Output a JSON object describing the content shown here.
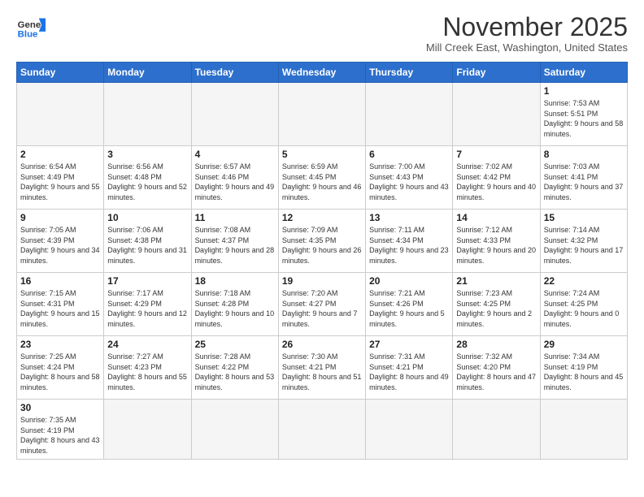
{
  "header": {
    "logo_general": "General",
    "logo_blue": "Blue",
    "month": "November 2025",
    "location": "Mill Creek East, Washington, United States"
  },
  "weekdays": [
    "Sunday",
    "Monday",
    "Tuesday",
    "Wednesday",
    "Thursday",
    "Friday",
    "Saturday"
  ],
  "weeks": [
    [
      {
        "day": "",
        "info": ""
      },
      {
        "day": "",
        "info": ""
      },
      {
        "day": "",
        "info": ""
      },
      {
        "day": "",
        "info": ""
      },
      {
        "day": "",
        "info": ""
      },
      {
        "day": "",
        "info": ""
      },
      {
        "day": "1",
        "info": "Sunrise: 7:53 AM\nSunset: 5:51 PM\nDaylight: 9 hours and 58 minutes."
      }
    ],
    [
      {
        "day": "2",
        "info": "Sunrise: 6:54 AM\nSunset: 4:49 PM\nDaylight: 9 hours and 55 minutes."
      },
      {
        "day": "3",
        "info": "Sunrise: 6:56 AM\nSunset: 4:48 PM\nDaylight: 9 hours and 52 minutes."
      },
      {
        "day": "4",
        "info": "Sunrise: 6:57 AM\nSunset: 4:46 PM\nDaylight: 9 hours and 49 minutes."
      },
      {
        "day": "5",
        "info": "Sunrise: 6:59 AM\nSunset: 4:45 PM\nDaylight: 9 hours and 46 minutes."
      },
      {
        "day": "6",
        "info": "Sunrise: 7:00 AM\nSunset: 4:43 PM\nDaylight: 9 hours and 43 minutes."
      },
      {
        "day": "7",
        "info": "Sunrise: 7:02 AM\nSunset: 4:42 PM\nDaylight: 9 hours and 40 minutes."
      },
      {
        "day": "8",
        "info": "Sunrise: 7:03 AM\nSunset: 4:41 PM\nDaylight: 9 hours and 37 minutes."
      }
    ],
    [
      {
        "day": "9",
        "info": "Sunrise: 7:05 AM\nSunset: 4:39 PM\nDaylight: 9 hours and 34 minutes."
      },
      {
        "day": "10",
        "info": "Sunrise: 7:06 AM\nSunset: 4:38 PM\nDaylight: 9 hours and 31 minutes."
      },
      {
        "day": "11",
        "info": "Sunrise: 7:08 AM\nSunset: 4:37 PM\nDaylight: 9 hours and 28 minutes."
      },
      {
        "day": "12",
        "info": "Sunrise: 7:09 AM\nSunset: 4:35 PM\nDaylight: 9 hours and 26 minutes."
      },
      {
        "day": "13",
        "info": "Sunrise: 7:11 AM\nSunset: 4:34 PM\nDaylight: 9 hours and 23 minutes."
      },
      {
        "day": "14",
        "info": "Sunrise: 7:12 AM\nSunset: 4:33 PM\nDaylight: 9 hours and 20 minutes."
      },
      {
        "day": "15",
        "info": "Sunrise: 7:14 AM\nSunset: 4:32 PM\nDaylight: 9 hours and 17 minutes."
      }
    ],
    [
      {
        "day": "16",
        "info": "Sunrise: 7:15 AM\nSunset: 4:31 PM\nDaylight: 9 hours and 15 minutes."
      },
      {
        "day": "17",
        "info": "Sunrise: 7:17 AM\nSunset: 4:29 PM\nDaylight: 9 hours and 12 minutes."
      },
      {
        "day": "18",
        "info": "Sunrise: 7:18 AM\nSunset: 4:28 PM\nDaylight: 9 hours and 10 minutes."
      },
      {
        "day": "19",
        "info": "Sunrise: 7:20 AM\nSunset: 4:27 PM\nDaylight: 9 hours and 7 minutes."
      },
      {
        "day": "20",
        "info": "Sunrise: 7:21 AM\nSunset: 4:26 PM\nDaylight: 9 hours and 5 minutes."
      },
      {
        "day": "21",
        "info": "Sunrise: 7:23 AM\nSunset: 4:25 PM\nDaylight: 9 hours and 2 minutes."
      },
      {
        "day": "22",
        "info": "Sunrise: 7:24 AM\nSunset: 4:25 PM\nDaylight: 9 hours and 0 minutes."
      }
    ],
    [
      {
        "day": "23",
        "info": "Sunrise: 7:25 AM\nSunset: 4:24 PM\nDaylight: 8 hours and 58 minutes."
      },
      {
        "day": "24",
        "info": "Sunrise: 7:27 AM\nSunset: 4:23 PM\nDaylight: 8 hours and 55 minutes."
      },
      {
        "day": "25",
        "info": "Sunrise: 7:28 AM\nSunset: 4:22 PM\nDaylight: 8 hours and 53 minutes."
      },
      {
        "day": "26",
        "info": "Sunrise: 7:30 AM\nSunset: 4:21 PM\nDaylight: 8 hours and 51 minutes."
      },
      {
        "day": "27",
        "info": "Sunrise: 7:31 AM\nSunset: 4:21 PM\nDaylight: 8 hours and 49 minutes."
      },
      {
        "day": "28",
        "info": "Sunrise: 7:32 AM\nSunset: 4:20 PM\nDaylight: 8 hours and 47 minutes."
      },
      {
        "day": "29",
        "info": "Sunrise: 7:34 AM\nSunset: 4:19 PM\nDaylight: 8 hours and 45 minutes."
      }
    ],
    [
      {
        "day": "30",
        "info": "Sunrise: 7:35 AM\nSunset: 4:19 PM\nDaylight: 8 hours and 43 minutes."
      },
      {
        "day": "",
        "info": ""
      },
      {
        "day": "",
        "info": ""
      },
      {
        "day": "",
        "info": ""
      },
      {
        "day": "",
        "info": ""
      },
      {
        "day": "",
        "info": ""
      },
      {
        "day": "",
        "info": ""
      }
    ]
  ]
}
